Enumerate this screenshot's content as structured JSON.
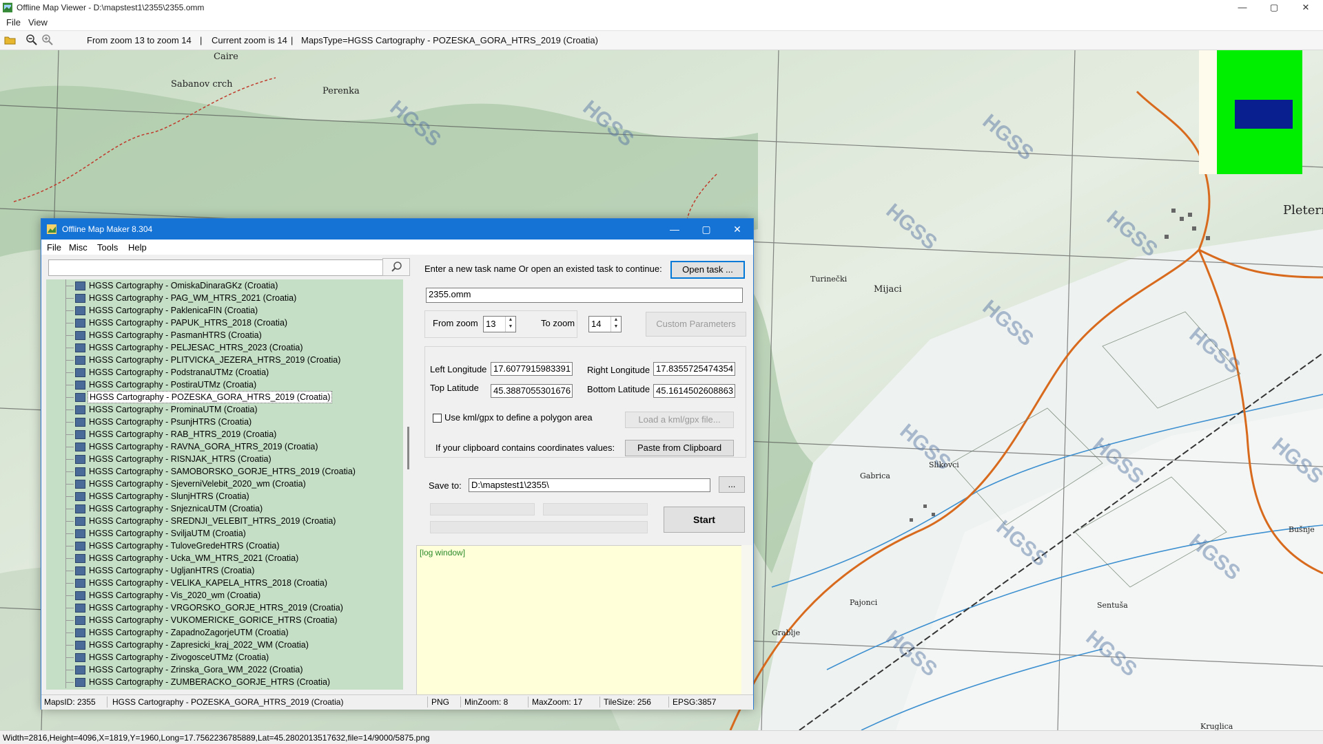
{
  "window": {
    "title": "Offline Map Viewer - D:\\mapstest1\\2355\\2355.omm",
    "menu": [
      "File",
      "View"
    ],
    "controls": {
      "minimize": "—",
      "maximize": "▢",
      "close": "✕"
    }
  },
  "toolbar": {
    "zoom_range": "From zoom 13 to zoom 14",
    "current_zoom": "Current zoom is 14",
    "maps_type": "MapsType=HGSS Cartography - POZESKA_GORA_HTRS_2019 (Croatia)",
    "sep1": "|",
    "sep2": "|"
  },
  "map": {
    "watermark": "HGSS",
    "place_labels": [
      "Caire",
      "Sabanov crch",
      "Perenka",
      "Pleternic",
      "Turinečki",
      "Mijaci",
      "Gabrica",
      "Slikovci",
      "Kruglica",
      "Bušnje",
      "Pajonci",
      "Grablje",
      "Sentuša"
    ]
  },
  "statusbar": {
    "text": "Width=2816,Height=4096,X=1819,Y=1960,Long=17.7562236785889,Lat=45.2802013517632,file=14/9000/5875.png"
  },
  "dialog": {
    "title": "Offline Map Maker 8.304",
    "menu": [
      "File",
      "Misc",
      "Tools",
      "Help"
    ],
    "search_icon": "magnifier-icon",
    "tree_items": [
      "HGSS Cartography - OmiskaDinaraGKz (Croatia)",
      "HGSS Cartography - PAG_WM_HTRS_2021 (Croatia)",
      "HGSS Cartography - PaklenicaFIN (Croatia)",
      "HGSS Cartography - PAPUK_HTRS_2018 (Croatia)",
      "HGSS Cartography - PasmanHTRS (Croatia)",
      "HGSS Cartography - PELJESAC_HTRS_2023 (Croatia)",
      "HGSS Cartography - PLITVICKA_JEZERA_HTRS_2019 (Croatia)",
      "HGSS Cartography - PodstranaUTMz (Croatia)",
      "HGSS Cartography - PostiraUTMz (Croatia)",
      "HGSS Cartography - POZESKA_GORA_HTRS_2019 (Croatia)",
      "HGSS Cartography - ProminaUTM (Croatia)",
      "HGSS Cartography - PsunjHTRS (Croatia)",
      "HGSS Cartography - RAB_HTRS_2019 (Croatia)",
      "HGSS Cartography - RAVNA_GORA_HTRS_2019 (Croatia)",
      "HGSS Cartography - RISNJAK_HTRS (Croatia)",
      "HGSS Cartography - SAMOBORSKO_GORJE_HTRS_2019 (Croatia)",
      "HGSS Cartography - SjeverniVelebit_2020_wm (Croatia)",
      "HGSS Cartography - SlunjHTRS (Croatia)",
      "HGSS Cartography - SnjeznicaUTM (Croatia)",
      "HGSS Cartography - SREDNJI_VELEBIT_HTRS_2019 (Croatia)",
      "HGSS Cartography - SviljaUTM (Croatia)",
      "HGSS Cartography - TuloveGredeHTRS (Croatia)",
      "HGSS Cartography - Ucka_WM_HTRS_2021 (Croatia)",
      "HGSS Cartography - UgljanHTRS (Croatia)",
      "HGSS Cartography - VELIKA_KAPELA_HTRS_2018 (Croatia)",
      "HGSS Cartography - Vis_2020_wm (Croatia)",
      "HGSS Cartography - VRGORSKO_GORJE_HTRS_2019 (Croatia)",
      "HGSS Cartography - VUKOMERICKE_GORICE_HTRS (Croatia)",
      "HGSS Cartography - ZapadnoZagorjeUTM (Croatia)",
      "HGSS Cartography - Zapresicki_kraj_2022_WM (Croatia)",
      "HGSS Cartography - ZivogosceUTMz (Croatia)",
      "HGSS Cartography - Zrinska_Gora_WM_2022 (Croatia)",
      "HGSS Cartography - ZUMBERACKO_GORJE_HTRS (Croatia)"
    ],
    "selected_index": 9,
    "task_prompt": "Enter a new task name Or open an existed task to continue:",
    "open_task_label": "Open task ...",
    "task_name": "2355.omm",
    "from_zoom_label": "From zoom",
    "from_zoom": "13",
    "to_zoom_label": "To zoom",
    "to_zoom": "14",
    "custom_params_label": "Custom Parameters",
    "left_lon_label": "Left Longitude",
    "left_lon": "17.6077915983391",
    "right_lon_label": "Right Longitude",
    "right_lon": "17.8355725474354",
    "top_lat_label": "Top Latitude",
    "top_lat": "45.3887055301676",
    "bottom_lat_label": "Bottom Latitude",
    "bottom_lat": "45.1614502608863",
    "kml_checkbox_label": "Use kml/gpx to define a polygon area",
    "kml_checked": false,
    "load_kml_label": "Load a kml/gpx file...",
    "clipboard_prompt": "If your clipboard contains coordinates values:",
    "paste_label": "Paste from Clipboard",
    "save_to_label": "Save to:",
    "save_to": "D:\\mapstest1\\2355\\",
    "browse_label": "...",
    "start_label": "Start",
    "log_text": "[log window]",
    "status": {
      "maps_id": "MapsID: 2355",
      "map_name": "HGSS Cartography - POZESKA_GORA_HTRS_2019 (Croatia)",
      "format": "PNG",
      "min_zoom": "MinZoom: 8",
      "max_zoom": "MaxZoom: 17",
      "tile_size": "TileSize: 256",
      "epsg": "EPSG:3857"
    }
  },
  "colors": {
    "dialog_title": "#1673d6",
    "tree_bg": "#c5dfc6",
    "log_bg": "#ffffd9",
    "overview_green": "#00ee00",
    "overview_rect": "#0a1f8f"
  }
}
